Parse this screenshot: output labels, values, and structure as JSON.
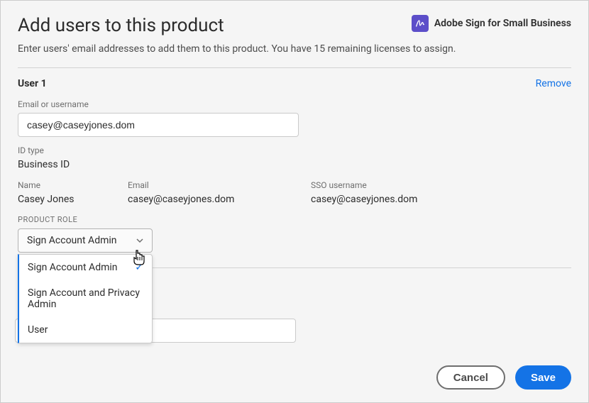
{
  "header": {
    "title": "Add users to this product",
    "product_name": "Adobe Sign for Small Business"
  },
  "subtitle": "Enter users' email addresses to add them to this product. You have 15 remaining licenses to assign.",
  "user": {
    "section_label": "User 1",
    "remove_label": "Remove",
    "email_label": "Email or username",
    "email_value": "casey@caseyjones.dom",
    "id_type_label": "ID type",
    "id_type_value": "Business ID",
    "name_label": "Name",
    "name_value": "Casey Jones",
    "email_col_label": "Email",
    "email_col_value": "casey@caseyjones.dom",
    "sso_label": "SSO username",
    "sso_value": "casey@caseyjones.dom",
    "role_label": "PRODUCT ROLE",
    "role_selected": "Sign Account Admin",
    "role_options": {
      "opt0": "Sign Account Admin",
      "opt1": "Sign Account and Privacy Admin",
      "opt2": "User"
    }
  },
  "footer": {
    "cancel_label": "Cancel",
    "save_label": "Save"
  }
}
